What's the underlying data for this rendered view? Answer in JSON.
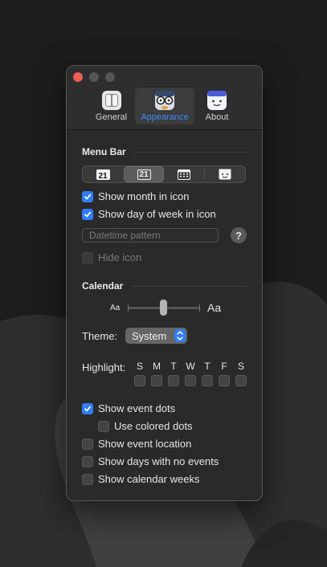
{
  "tabs": [
    {
      "label": "General",
      "icon": "general-toggle-icon"
    },
    {
      "label": "Appearance",
      "icon": "appearance-face-icon"
    },
    {
      "label": "About",
      "icon": "about-face-icon"
    }
  ],
  "selected_tab": "Appearance",
  "menu_bar": {
    "title": "Menu Bar",
    "icon_styles": [
      {
        "text": "21",
        "icon": "calendar-filled-icon"
      },
      {
        "text": "21",
        "icon": "calendar-outline-icon",
        "selected": true
      },
      {
        "text": "",
        "icon": "calendar-grid-icon"
      },
      {
        "text": "",
        "icon": "calendar-face-icon"
      }
    ],
    "show_month_in_icon": {
      "label": "Show month in icon",
      "checked": true
    },
    "show_day_of_week_in_icon": {
      "label": "Show day of week in icon",
      "checked": true
    },
    "datetime_pattern": {
      "placeholder": "Datetime pattern",
      "value": ""
    },
    "help": "?",
    "hide_icon": {
      "label": "Hide icon",
      "checked": false,
      "disabled": true
    }
  },
  "calendar": {
    "title": "Calendar",
    "text_size": {
      "small_label": "Aa",
      "large_label": "Aa",
      "value": 0.5
    },
    "theme": {
      "label": "Theme:",
      "value": "System"
    },
    "highlight": {
      "label": "Highlight:",
      "days": [
        "S",
        "M",
        "T",
        "W",
        "T",
        "F",
        "S"
      ],
      "checked": [
        false,
        false,
        false,
        false,
        false,
        false,
        false
      ]
    },
    "show_event_dots": {
      "label": "Show event dots",
      "checked": true
    },
    "use_colored_dots": {
      "label": "Use colored dots",
      "checked": false
    },
    "show_event_location": {
      "label": "Show event location",
      "checked": false
    },
    "show_days_with_no_events": {
      "label": "Show days with no events",
      "checked": false
    },
    "show_calendar_weeks": {
      "label": "Show calendar weeks",
      "checked": false
    }
  },
  "colors": {
    "accent": "#2f7cf6",
    "close_button": "#ee5d56",
    "window_bg": "#2a2a2a"
  }
}
